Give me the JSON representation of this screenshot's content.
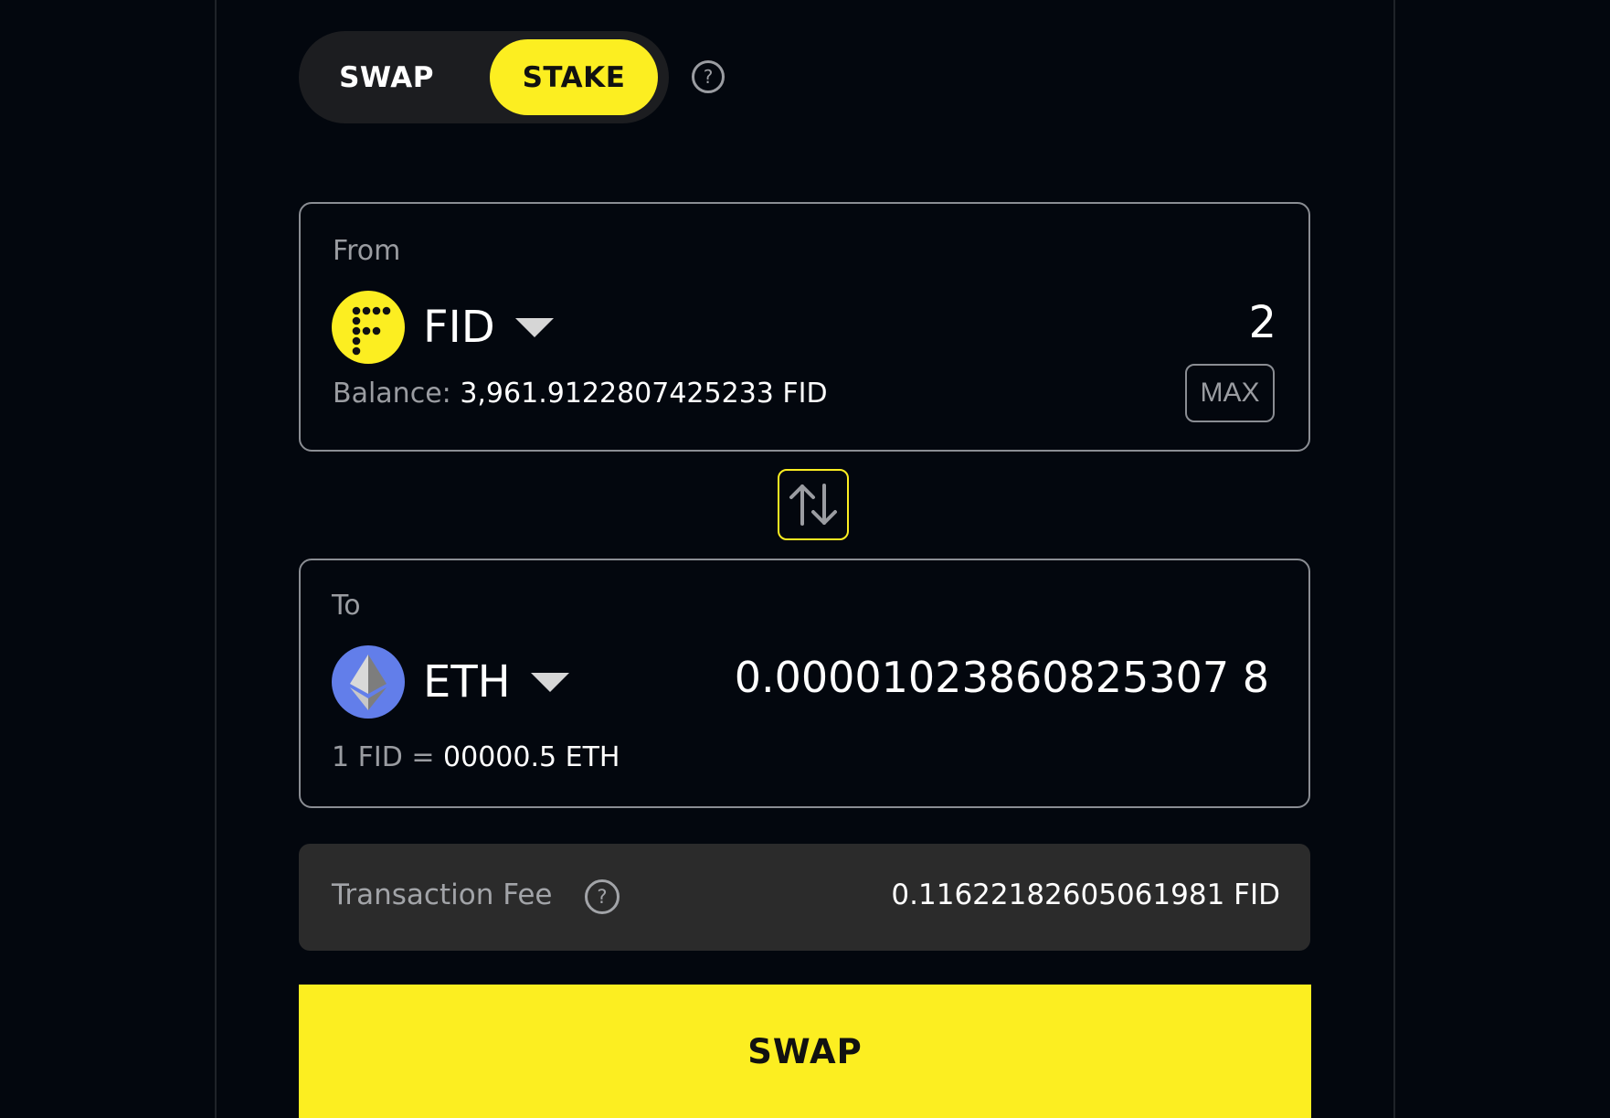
{
  "mode_toggle": {
    "swap_label": "SWAP",
    "stake_label": "STAKE",
    "active": "STAKE"
  },
  "from": {
    "label": "From",
    "token": "FID",
    "token_icon": "fid-coin-icon",
    "amount": "2",
    "balance_label": "Balance:",
    "balance_value": "3,961.9122807425233 FID",
    "max_label": "MAX"
  },
  "to": {
    "label": "To",
    "token": "ETH",
    "token_icon": "eth-coin-icon",
    "amount": "0.00001023860825307 8",
    "rate_prefix": "1 FID =",
    "rate_value": "00000.5 ETH"
  },
  "fee": {
    "label": "Transaction Fee",
    "value": "0.11622182605061981 FID"
  },
  "submit": {
    "label": "SWAP"
  },
  "colors": {
    "background": "#03070e",
    "accent": "#fcee21",
    "panel_border": "#8a8d93",
    "fee_bar": "#2b2b2b",
    "eth_coin": "#627eea"
  }
}
